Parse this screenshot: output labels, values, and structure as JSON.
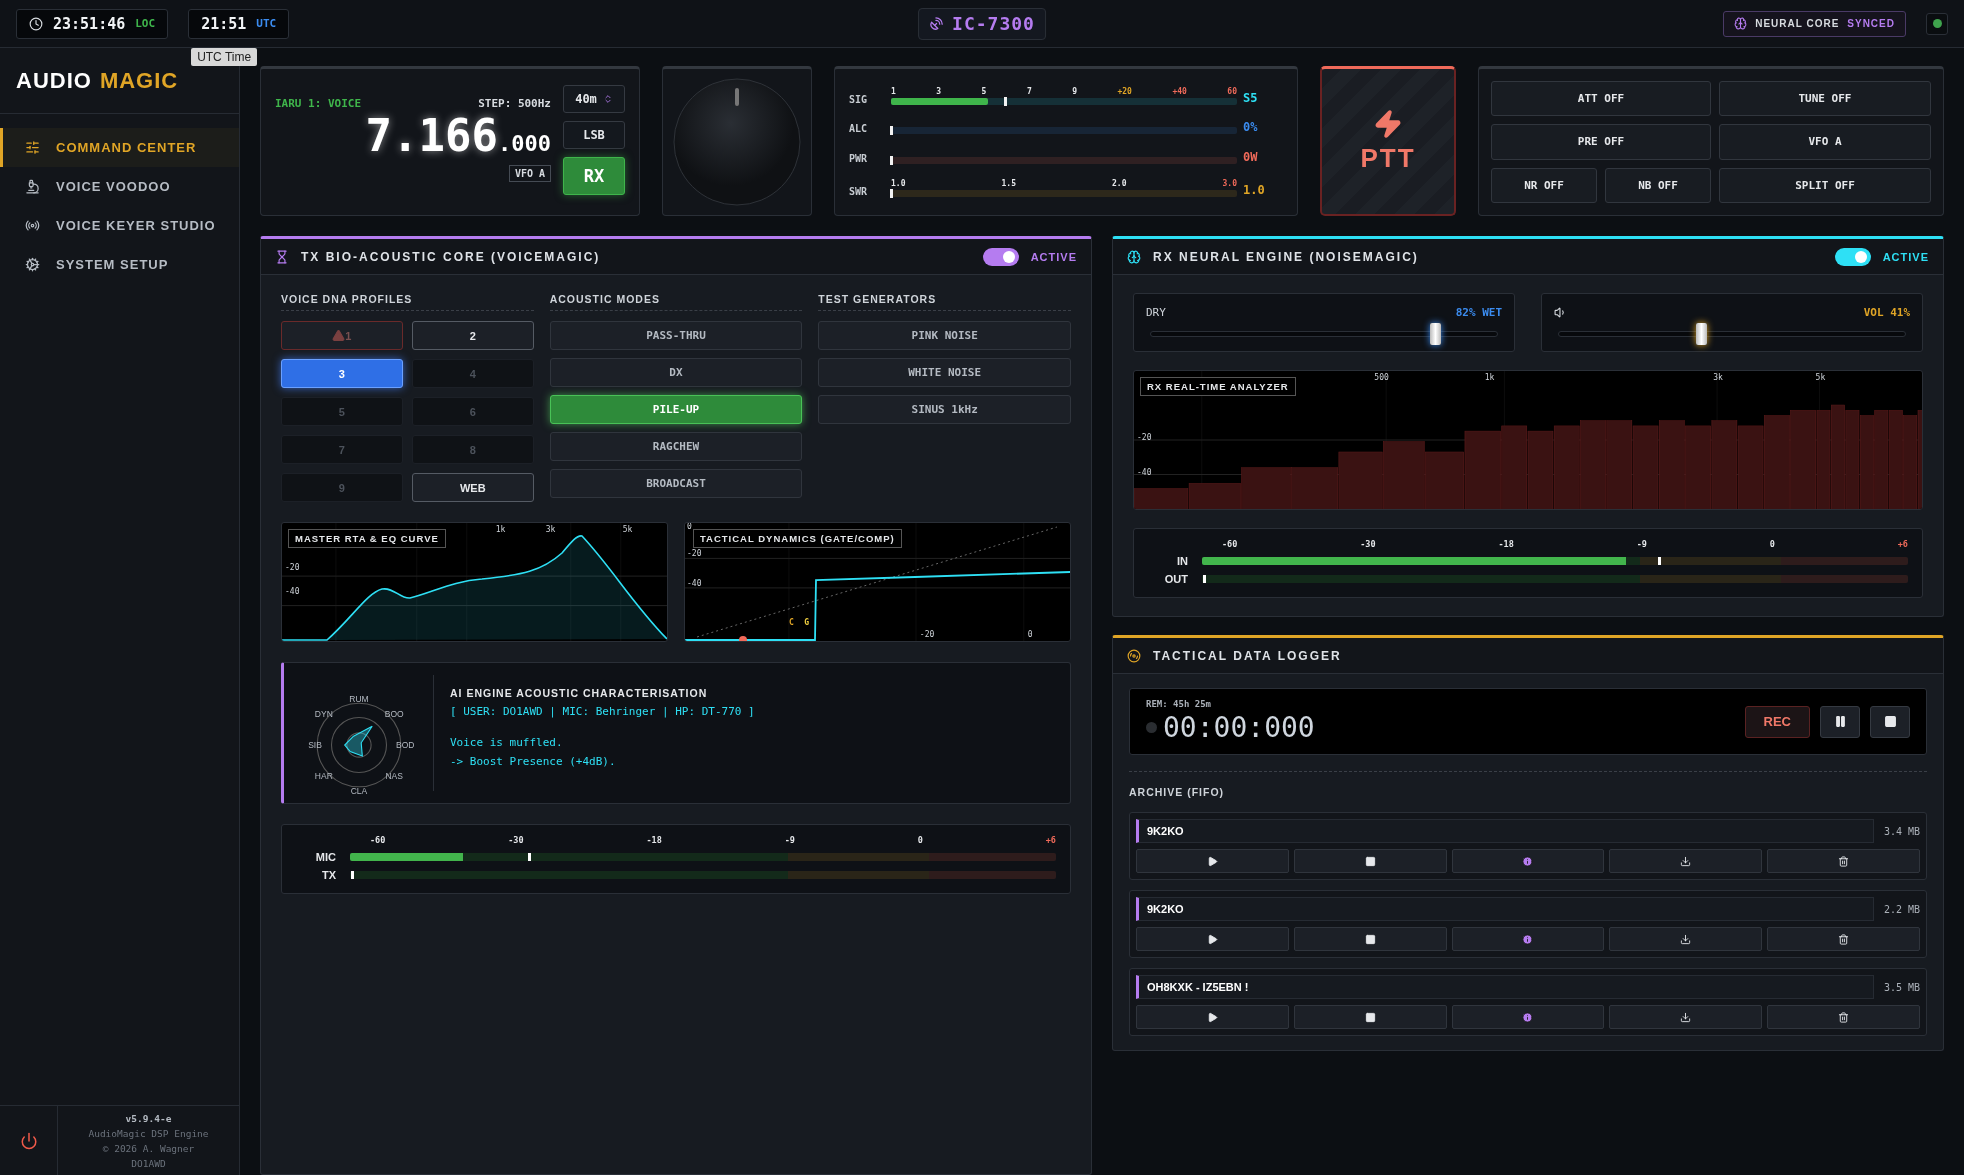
{
  "top_bar": {
    "clocks": [
      {
        "time": "23:51:46",
        "zone": "LOC",
        "kind": "local"
      },
      {
        "time": "21:51",
        "zone": "UTC",
        "kind": "utc"
      }
    ],
    "tooltip": "UTC Time",
    "radio": "IC-7300",
    "status": {
      "label": "NEURAL CORE",
      "state": "SYNCED"
    },
    "link_on": true
  },
  "sidebar": {
    "brand": {
      "first": "AUDIO",
      "second": "MAGIC"
    },
    "items": [
      {
        "label": "COMMAND CENTER",
        "selected": true
      },
      {
        "label": "VOICE VOODOO",
        "selected": false
      },
      {
        "label": "VOICE KEYER STUDIO",
        "selected": false
      },
      {
        "label": "SYSTEM SETUP",
        "selected": false
      }
    ],
    "footer": {
      "version": "v5.9.4-e",
      "lines": [
        "AudioMagic DSP Engine",
        "© 2026 A. Wagner",
        "DO1AWD"
      ]
    }
  },
  "vfo": {
    "band_plan": "IARU 1: VOICE",
    "step": "STEP: 500Hz",
    "frequency": "7.166",
    "fraction": ".000",
    "vfo": "VFO A",
    "band": "40m",
    "mode": "LSB",
    "rx": "RX"
  },
  "meters": [
    {
      "label": "SIG",
      "ticks": [
        {
          "label": "1"
        },
        {
          "label": "3"
        },
        {
          "label": "5"
        },
        {
          "label": "7"
        },
        {
          "label": "9"
        },
        {
          "label": "+20",
          "color": "#e0a526"
        },
        {
          "label": "+40",
          "color": "#f06a5a"
        },
        {
          "label": "60",
          "color": "#f06a5a"
        }
      ],
      "level": 0.28,
      "peak": {
        "level": 0.33
      },
      "reading": "S5",
      "color": "#2ee0f5"
    },
    {
      "label": "ALC",
      "level": 0,
      "peak": {
        "level": 0
      },
      "reading": "0%",
      "color": "#3b8cf0"
    },
    {
      "label": "PWR",
      "level": 0,
      "peak": {
        "level": 0
      },
      "reading": "0W",
      "color": "#f06a5a"
    },
    {
      "label": "SWR",
      "ticks": [
        {
          "label": "1.0"
        },
        {
          "label": "1.5"
        },
        {
          "label": "2.0"
        },
        {
          "label": "3.0",
          "color": "#f06a5a"
        }
      ],
      "level": 0,
      "peak": {
        "level": 0
      },
      "reading": "1.0",
      "color": "#e0a526"
    }
  ],
  "ptt": {
    "label": "PTT"
  },
  "controls": [
    "ATT OFF",
    "TUNE OFF",
    "PRE OFF",
    "VFO A",
    "NR OFF",
    "NB OFF",
    "SPLIT OFF"
  ],
  "tx": {
    "title": "TX BIO-ACOUSTIC CORE (VOICEMAGIC)",
    "toggle": {
      "label": "ACTIVE",
      "on": true
    },
    "profiles": {
      "title": "VOICE DNA PROFILES",
      "items": [
        {
          "label": "1",
          "selected": false,
          "warning": true,
          "empty": false
        },
        {
          "label": "2",
          "selected": false,
          "warning": false,
          "empty": false
        },
        {
          "label": "3",
          "selected": true,
          "warning": false,
          "empty": false
        },
        {
          "label": "4",
          "selected": false,
          "warning": false,
          "empty": true
        },
        {
          "label": "5",
          "selected": false,
          "warning": false,
          "empty": true
        },
        {
          "label": "6",
          "selected": false,
          "warning": false,
          "empty": true
        },
        {
          "label": "7",
          "selected": false,
          "warning": false,
          "empty": true
        },
        {
          "label": "8",
          "selected": false,
          "warning": false,
          "empty": true
        },
        {
          "label": "9",
          "selected": false,
          "warning": false,
          "empty": true
        },
        {
          "label": "WEB",
          "selected": false,
          "warning": false,
          "empty": false
        }
      ]
    },
    "modes": {
      "title": "ACOUSTIC MODES",
      "items": [
        {
          "label": "PASS-THRU",
          "selected": false
        },
        {
          "label": "DX",
          "selected": false
        },
        {
          "label": "PILE-UP",
          "selected": true
        },
        {
          "label": "RAGCHEW",
          "selected": false
        },
        {
          "label": "BROADCAST",
          "selected": false
        }
      ]
    },
    "generators": {
      "title": "TEST GENERATORS",
      "items": [
        {
          "label": "PINK NOISE",
          "selected": false
        },
        {
          "label": "WHITE NOISE",
          "selected": false
        },
        {
          "label": "SINUS 1kHz",
          "selected": false
        }
      ]
    },
    "eq": {
      "title": "MASTER RTA & EQ CURVE",
      "x_ticks": [
        "1k",
        "3k",
        "5k"
      ],
      "y_ticks": [
        "-20",
        "-40"
      ]
    },
    "dynamics": {
      "title": "TACTICAL DYNAMICS (GATE/COMP)",
      "x_ticks": [
        "-20",
        "0"
      ],
      "y_ticks": [
        "0",
        "-20",
        "-40"
      ],
      "markers": [
        "C",
        "G"
      ]
    },
    "ai": {
      "radar_labels": [
        "RUM",
        "BOO",
        "BOD",
        "NAS",
        "CLA",
        "HAR",
        "SIB",
        "DYN"
      ],
      "title": "AI ENGINE ACOUSTIC CHARACTERISATION",
      "profile": "[ USER: DO1AWD | MIC: Behringer | HP: DT-770 ]",
      "advice": [
        "Voice is muffled.",
        "-> Boost Presence (+4dB)."
      ]
    },
    "scale": [
      {
        "label": "-60"
      },
      {
        "label": "-30"
      },
      {
        "label": "-18"
      },
      {
        "label": "-9"
      },
      {
        "label": "0"
      },
      {
        "label": "+6",
        "color": "#f06a5a"
      }
    ],
    "levels": [
      {
        "label": "MIC",
        "level": 0.16,
        "peak": {
          "level": 0.25
        }
      },
      {
        "label": "TX",
        "level": 0,
        "peak": {
          "level": 0
        }
      }
    ]
  },
  "rx": {
    "title": "RX NEURAL ENGINE (NOISEMAGIC)",
    "toggle": {
      "label": "ACTIVE",
      "on": true
    },
    "mix": {
      "label": "DRY",
      "reading": "82% WET",
      "level": 0.82
    },
    "volume": {
      "reading": "VOL 41%",
      "level": 0.41
    },
    "analyzer": {
      "title": "RX REAL-TIME ANALYZER",
      "x_ticks": [
        "500",
        "1k",
        "3k",
        "5k"
      ],
      "y_ticks": [
        "-20",
        "-40"
      ]
    },
    "scale": [
      {
        "label": "-60"
      },
      {
        "label": "-30"
      },
      {
        "label": "-18"
      },
      {
        "label": "-9"
      },
      {
        "label": "0"
      },
      {
        "label": "+6",
        "color": "#f06a5a"
      }
    ],
    "levels": [
      {
        "label": "IN",
        "level": 0.6,
        "peak": {
          "level": 0.645
        }
      },
      {
        "label": "OUT",
        "level": 0,
        "peak": {
          "level": 0
        }
      }
    ]
  },
  "logger": {
    "title": "TACTICAL DATA LOGGER",
    "remaining": "REM: 45h 25m",
    "time": "00:00:000",
    "recording": false,
    "rec": "REC",
    "archive_title": "ARCHIVE (FIFO)",
    "recordings": [
      {
        "name": "9K2KO",
        "size": "3.4 MB"
      },
      {
        "name": "9K2KO",
        "size": "2.2 MB"
      },
      {
        "name": "OH8KXK - IZ5EBN !",
        "size": "3.5 MB"
      }
    ]
  }
}
